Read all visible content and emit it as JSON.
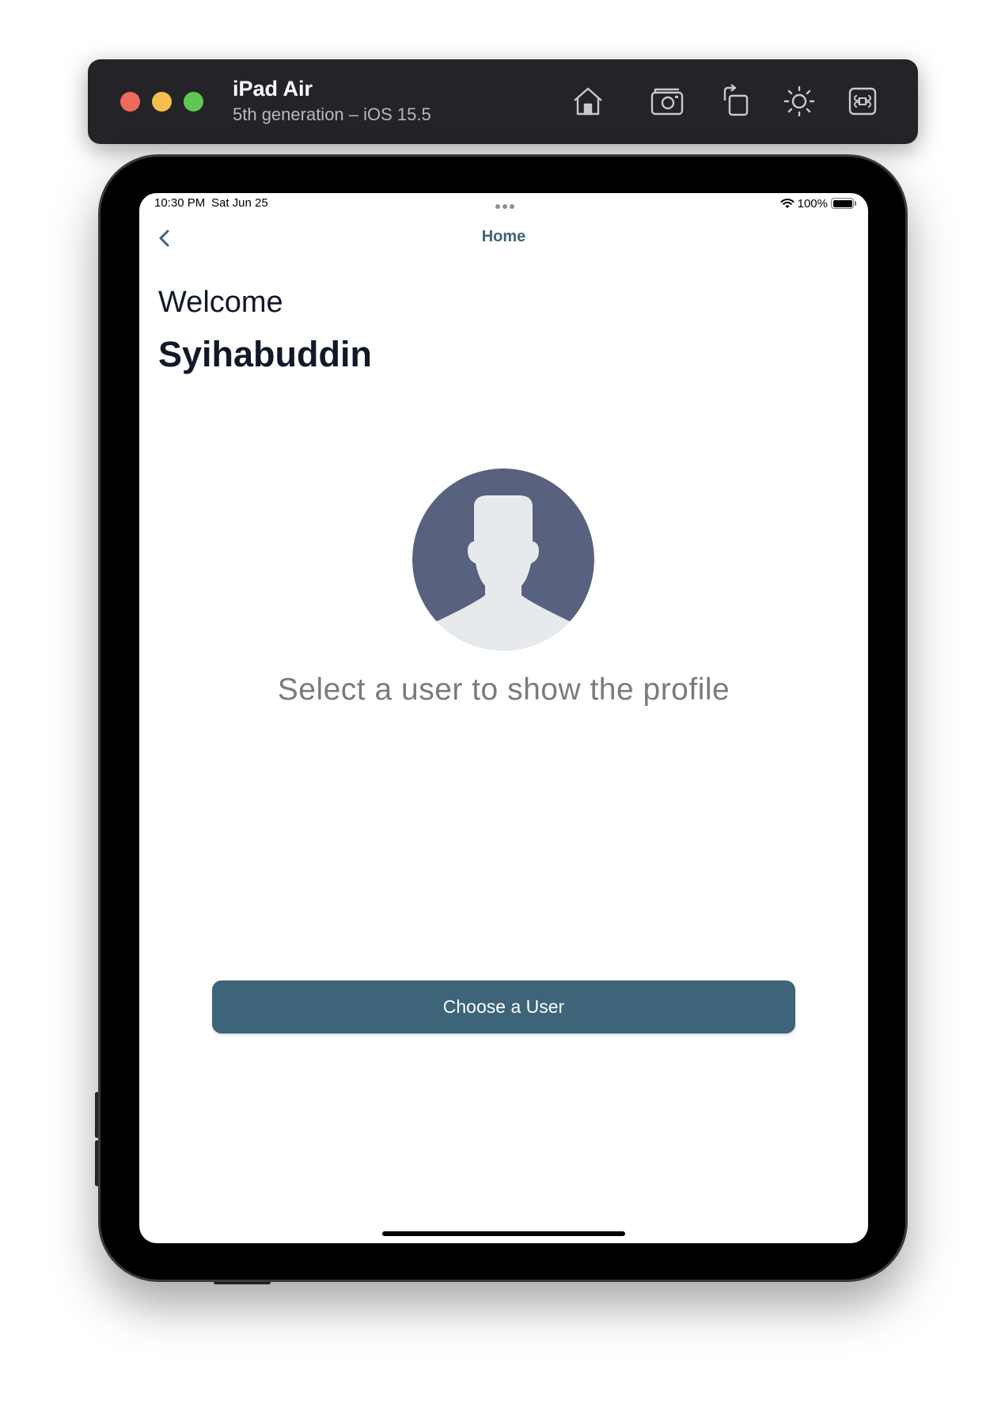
{
  "simulator": {
    "device_name": "iPad Air",
    "device_detail": "5th generation – iOS 15.5",
    "tools": [
      "home-icon",
      "screenshot-icon",
      "rotate-icon",
      "appearance-icon",
      "command-icon"
    ]
  },
  "status_bar": {
    "time": "10:30 PM",
    "date": "Sat Jun 25",
    "battery": "100%"
  },
  "nav": {
    "title": "Home",
    "back_icon": "chevron-left-icon"
  },
  "main": {
    "welcome": "Welcome",
    "username": "Syihabuddin",
    "avatar_icon": "user-avatar-icon",
    "placeholder": "Select a user to show the profile",
    "choose_button": "Choose a User"
  },
  "colors": {
    "accent": "#3d6478",
    "avatar_bg": "#58617d",
    "avatar_fg": "#e7eaec",
    "heading": "#111827",
    "muted": "#7b7b7f",
    "sim_bar": "#242328"
  }
}
